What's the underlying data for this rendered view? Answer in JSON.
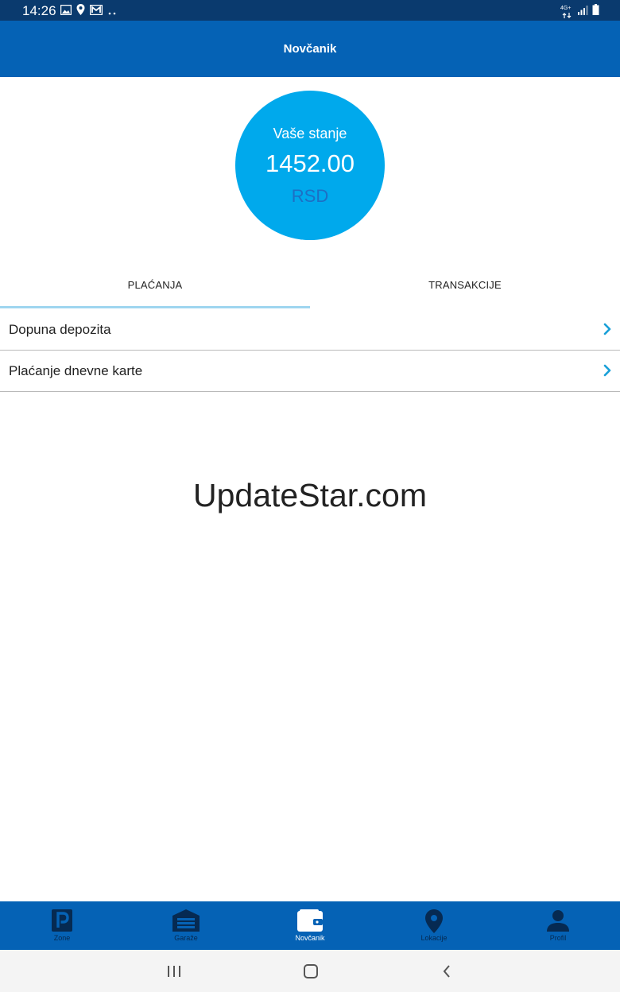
{
  "status_bar": {
    "time": "14:26",
    "left_icons": [
      "image-icon",
      "location-icon",
      "mail-icon",
      "more-dots-icon"
    ],
    "right_icons": [
      "network-4g-icon",
      "signal-icon",
      "battery-icon"
    ],
    "network_label": "4G+"
  },
  "header": {
    "title": "Novčanik"
  },
  "balance": {
    "label": "Vaše stanje",
    "amount": "1452.00",
    "currency": "RSD"
  },
  "tabs": [
    {
      "label": "PLAĆANJA",
      "active": true
    },
    {
      "label": "TRANSAKCIJE",
      "active": false
    }
  ],
  "list": [
    {
      "label": "Dopuna depozita",
      "icon": "chevron-right-icon"
    },
    {
      "label": "Plaćanje dnevne karte",
      "icon": "chevron-right-icon"
    }
  ],
  "watermark": "UpdateStar.com",
  "bottom_nav": [
    {
      "label": "Zone",
      "icon": "parking-icon",
      "active": false
    },
    {
      "label": "Garaže",
      "icon": "garage-icon",
      "active": false
    },
    {
      "label": "Novčanik",
      "icon": "wallet-icon",
      "active": true
    },
    {
      "label": "Lokacije",
      "icon": "location-pin-icon",
      "active": false
    },
    {
      "label": "Profil",
      "icon": "user-icon",
      "active": false
    }
  ],
  "system_nav": [
    "recent-apps-icon",
    "home-icon",
    "back-icon"
  ],
  "colors": {
    "status_bar": "#0a3a6e",
    "header": "#0562b5",
    "balance_circle": "#00a9ec",
    "currency_text": "#1d6fc4",
    "chevron": "#1aa0d8",
    "tab_indicator": "#9fd6f0",
    "nav_icon_inactive": "#062a52"
  }
}
